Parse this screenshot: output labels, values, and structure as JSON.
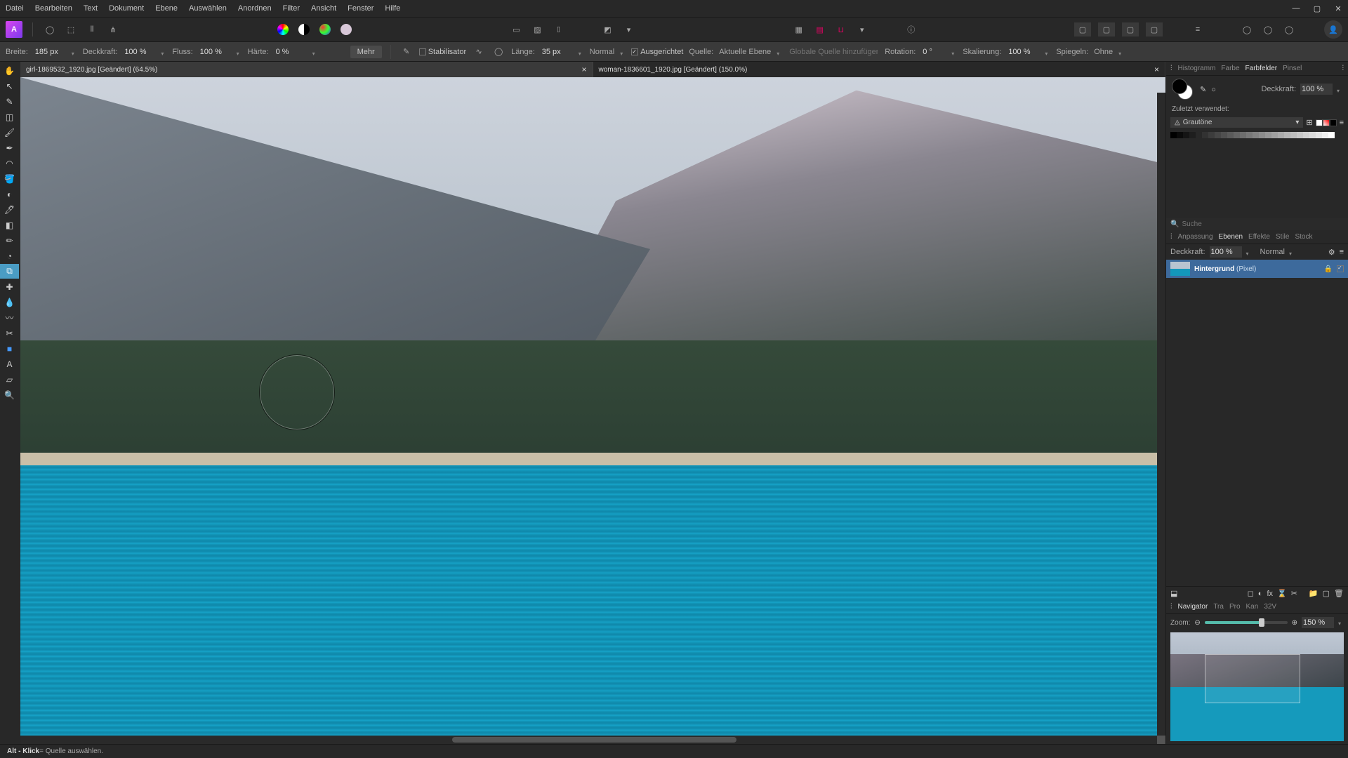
{
  "menu": [
    "Datei",
    "Bearbeiten",
    "Text",
    "Dokument",
    "Ebene",
    "Auswählen",
    "Anordnen",
    "Filter",
    "Ansicht",
    "Fenster",
    "Hilfe"
  ],
  "context": {
    "width_label": "Breite:",
    "width_value": "185 px",
    "opacity_label": "Deckkraft:",
    "opacity_value": "100 %",
    "flow_label": "Fluss:",
    "flow_value": "100 %",
    "hardness_label": "Härte:",
    "hardness_value": "0 %",
    "more": "Mehr",
    "stabiliser": "Stabilisator",
    "length_label": "Länge:",
    "length_value": "35 px",
    "blend": "Normal",
    "aligned": "Ausgerichtet",
    "source_label": "Quelle:",
    "source_value": "Aktuelle Ebene",
    "global_placeholder": "Globale Quelle hinzufügen",
    "rotation_label": "Rotation:",
    "rotation_value": "0 °",
    "scale_label": "Skalierung:",
    "scale_value": "100 %",
    "mirror_label": "Spiegeln:",
    "mirror_value": "Ohne"
  },
  "tabs": [
    {
      "label": "girl-1869532_1920.jpg [Geändert] (64.5%)",
      "active": true
    },
    {
      "label": "woman-1836601_1920.jpg [Geändert] (150.0%)",
      "active": false
    }
  ],
  "right_tabs_top": [
    "Histogramm",
    "Farbe",
    "Farbfelder",
    "Pinsel"
  ],
  "right_tabs_top_active": 2,
  "swatch_opacity_label": "Deckkraft:",
  "swatch_opacity_value": "100 %",
  "recent_label": "Zuletzt verwendet:",
  "swatch_type": "Grautöne",
  "search_placeholder": "Suche",
  "mid_tabs": [
    "Anpassung",
    "Ebenen",
    "Effekte",
    "Stile",
    "Stock"
  ],
  "mid_tabs_active": 1,
  "layer_opacity_label": "Deckkraft:",
  "layer_opacity_value": "100 %",
  "layer_blend": "Normal",
  "layer_name_bold": "Hintergrund",
  "layer_name_type": "(Pixel)",
  "nav_tabs": [
    "Navigator",
    "Tra",
    "Pro",
    "Kan",
    "32V"
  ],
  "nav_tabs_active": 0,
  "zoom_label": "Zoom:",
  "zoom_value": "150 %",
  "status_key": "Alt - Klick",
  "status_text": " = Quelle auswählen."
}
